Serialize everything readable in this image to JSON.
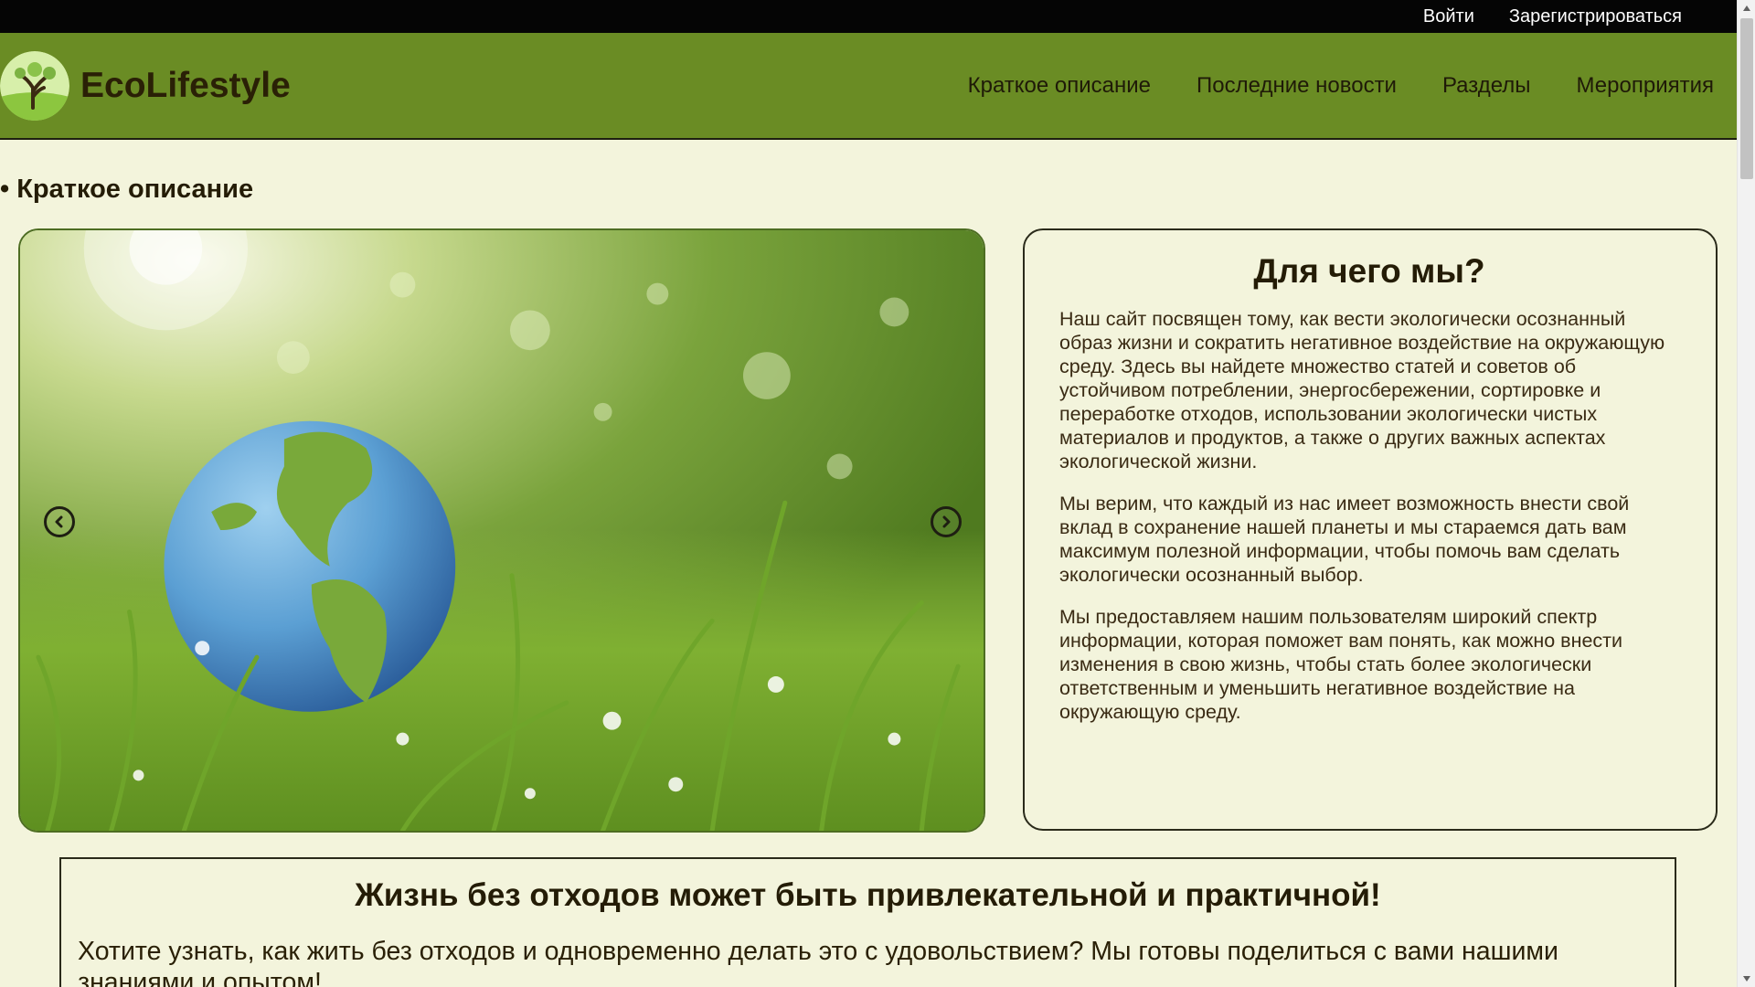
{
  "auth": {
    "login": "Войти",
    "register": "Зарегистрироваться"
  },
  "header": {
    "brand": "EcoLifestyle",
    "nav": [
      "Краткое описание",
      "Последние новости",
      "Разделы",
      "Мероприятия"
    ]
  },
  "section": {
    "title": "• Краткое описание"
  },
  "slider": {
    "image_icon": "earth-globe-in-grass",
    "prev_icon": "chevron-left-icon",
    "next_icon": "chevron-right-icon"
  },
  "about": {
    "title": "Для чего мы?",
    "paragraphs": [
      "Наш сайт посвящен тому, как вести экологически осознанный образ жизни и сократить негативное воздействие на окружающую среду. Здесь вы найдете множество статей и советов об устойчивом потреблении, энергосбережении, сортировке и переработке отходов, использовании экологически чистых материалов и продуктов, а также о других важных аспектах экологической жизни.",
      "Мы верим, что каждый из нас имеет возможность внести свой вклад в сохранение нашей планеты и мы стараемся дать вам максимум полезной информации, чтобы помочь вам сделать экологически осознанный выбор.",
      "Мы предоставляем нашим пользователям широкий спектр информации, которая поможет вам понять, как можно внести изменения в свою жизнь, чтобы стать более экологически ответственным и уменьшить негативное воздействие на окружающую среду."
    ]
  },
  "zero_waste": {
    "title": "Жизнь без отходов может быть привлекательной и практичной!",
    "text": "Хотите узнать, как жить без отходов и одновременно делать это с удовольствием? Мы готовы поделиться с вами нашими знаниями и опытом!"
  },
  "colors": {
    "topbar": "#050505",
    "header": "#6a8c24",
    "page_bg": "#f3f4dc",
    "text_dark": "#241c06"
  }
}
